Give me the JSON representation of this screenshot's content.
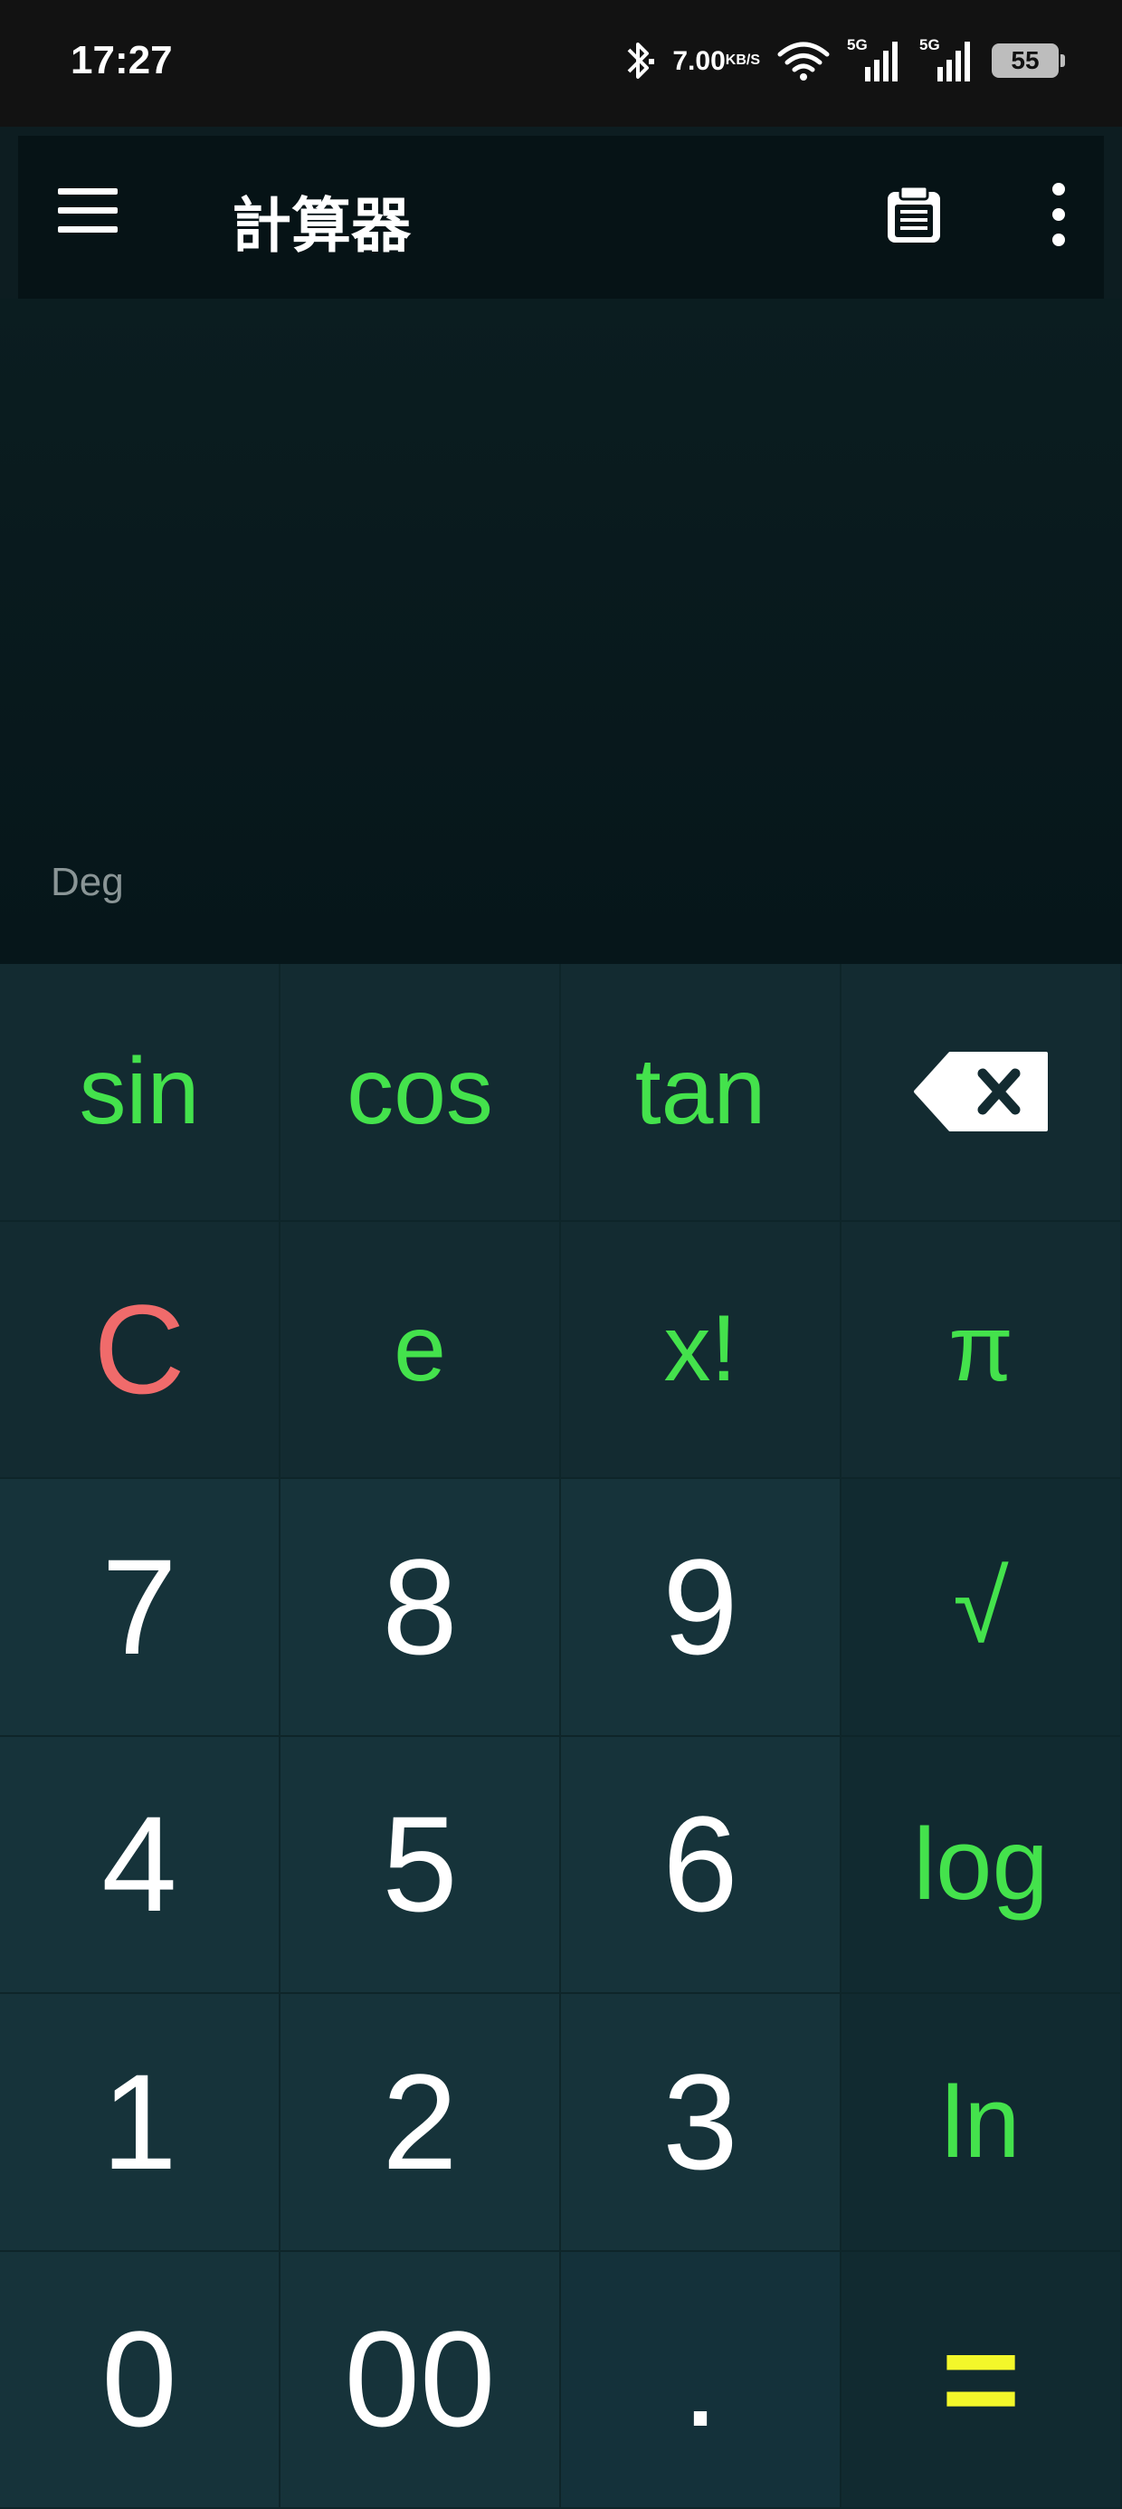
{
  "status_bar": {
    "time": "17:27",
    "net_speed_value": "7.00",
    "net_speed_unit": "KB/S",
    "signal1_label": "5G",
    "signal2_label": "5G",
    "battery": "55"
  },
  "app_bar": {
    "title": "計算器",
    "menu_icon": "hamburger-menu-icon",
    "clipboard_icon": "clipboard-icon",
    "more_icon": "more-vert-icon"
  },
  "display": {
    "angle_mode": "Deg"
  },
  "keys": {
    "sin": "sin",
    "cos": "cos",
    "tan": "tan",
    "backspace_icon": "backspace-icon",
    "clear": "C",
    "e": "e",
    "factorial": "x!",
    "pi": "π",
    "seven": "7",
    "eight": "8",
    "nine": "9",
    "sqrt": "√",
    "four": "4",
    "five": "5",
    "six": "6",
    "log": "log",
    "one": "1",
    "two": "2",
    "three": "3",
    "ln": "ln",
    "zero": "0",
    "double_zero": "00",
    "dot": ".",
    "equals": "="
  },
  "colors": {
    "function_key": "#44e24c",
    "clear_key": "#f06b6b",
    "equals_key": "#f3f72a",
    "digit_key": "#ffffff",
    "background": "#0d1d21"
  }
}
